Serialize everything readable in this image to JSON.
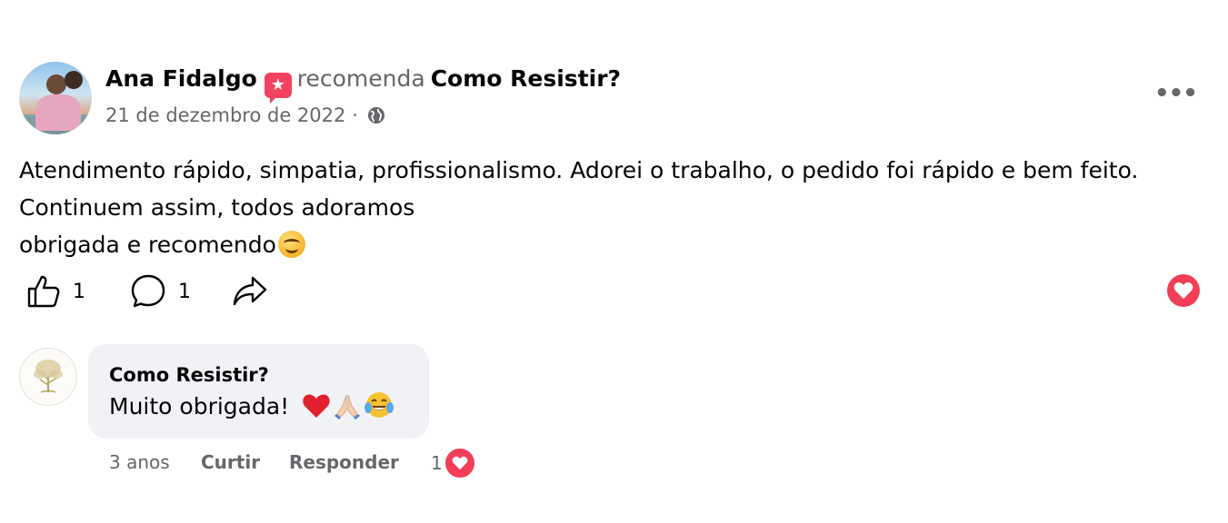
{
  "post": {
    "author_name": "Ana Fidalgo",
    "recommends_word": "recomenda",
    "page_name": "Como Resistir?",
    "date": "21 de dezembro de 2022",
    "separator": "·",
    "more_label": "•••",
    "text_lines": [
      "Atendimento rápido, simpatia, profissionalismo. Adorei o trabalho, o pedido foi rápido e bem feito.",
      "Continuem assim, todos adoramos",
      "obrigada e recomendo"
    ],
    "icons": {
      "recommend": "recommend-icon",
      "globe": "globe-icon",
      "smile_emoji": "smiling-face-emoji"
    }
  },
  "actions": {
    "like_count": "1",
    "comment_count": "1",
    "icons": [
      "like-icon",
      "comment-icon",
      "share-icon",
      "love-reaction-icon"
    ]
  },
  "comment": {
    "author": "Como Resistir?",
    "text": "Muito obrigada!",
    "emojis": [
      "red-heart",
      "folded-hands",
      "grinning-tears"
    ],
    "time": "3 anos",
    "like_label": "Curtir",
    "reply_label": "Responder",
    "reaction_count": "1"
  },
  "colors": {
    "secondary_text": "#65676b",
    "bubble_bg": "#f0f2f5",
    "love_red": "#f33e58",
    "recommend_pink": "#f3425f"
  }
}
